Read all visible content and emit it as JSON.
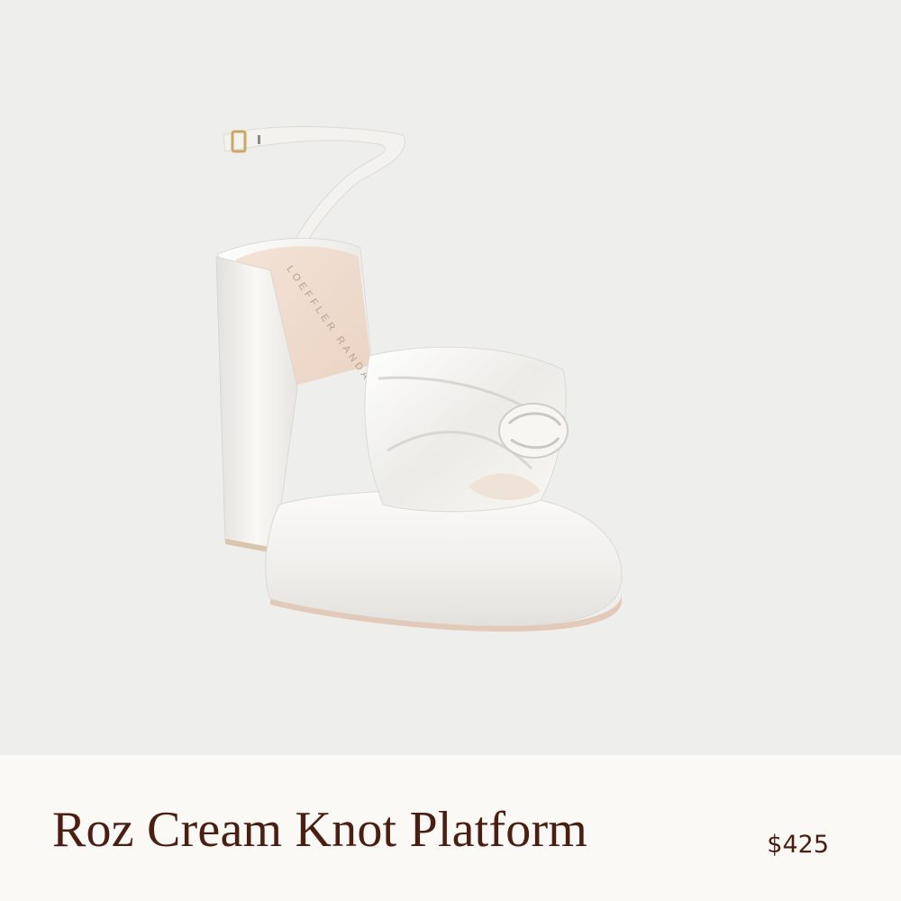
{
  "product": {
    "name": "Roz Cream Knot Platform",
    "price": "$425",
    "image_brand_stamp": "LOEFFLER RANDALL",
    "colors": {
      "background": "#eeeeec",
      "caption_bg": "#fbf9f5",
      "text": "#4a1f12",
      "shoe": "#f6f5f2"
    }
  }
}
